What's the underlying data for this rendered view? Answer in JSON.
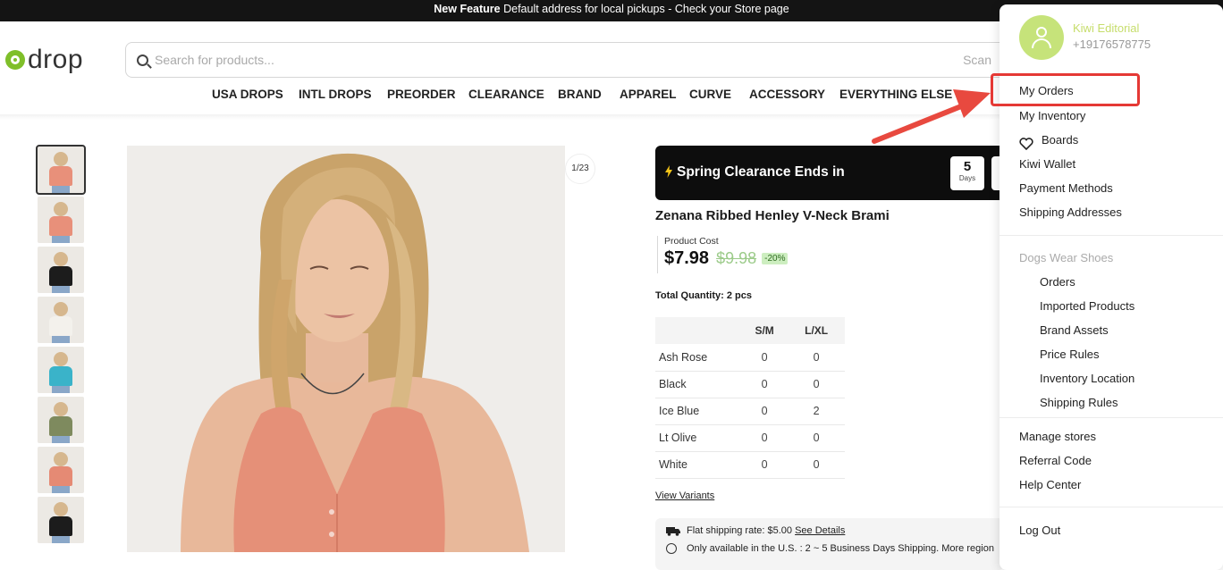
{
  "announcement": {
    "bold": "New Feature",
    "text": " Default address for local pickups - Check your Store page"
  },
  "logo": {
    "text": "drop",
    "icon": "drop-logo-icon"
  },
  "search": {
    "placeholder": "Search for products...",
    "scan_label": "Scan"
  },
  "nav": [
    {
      "label": "USA DROPS"
    },
    {
      "label": "INTL DROPS"
    },
    {
      "label": "PREORDER"
    },
    {
      "label": "CLEARANCE"
    },
    {
      "label": "BRAND"
    },
    {
      "label": "APPAREL"
    },
    {
      "label": "CURVE"
    },
    {
      "label": "ACCESSORY"
    },
    {
      "label": "EVERYTHING ELSE"
    }
  ],
  "gallery": {
    "counter": "1/23",
    "thumbnails": [
      {
        "color": "#e8907a"
      },
      {
        "color": "#e8907a"
      },
      {
        "color": "#1c1c1c"
      },
      {
        "color": "#f3f1ec"
      },
      {
        "color": "#3ab3c9"
      },
      {
        "color": "#7e8a5e"
      },
      {
        "color": "#e58a74"
      },
      {
        "color": "#1c1c1c"
      }
    ]
  },
  "promo": {
    "text": "Spring Clearance Ends in",
    "days_value": "5",
    "days_label": "Days"
  },
  "product": {
    "title": "Zenana Ribbed Henley V-Neck Brami",
    "cost_label": "Product Cost",
    "price": "$7.98",
    "old_price": "$9.98",
    "discount": "-20%",
    "total_quantity": "Total Quantity: 2 pcs"
  },
  "variants": {
    "headers": [
      "",
      "S/M",
      "L/XL"
    ],
    "rows": [
      {
        "color": "Ash Rose",
        "sm": "0",
        "lxl": "0"
      },
      {
        "color": "Black",
        "sm": "0",
        "lxl": "0"
      },
      {
        "color": "Ice Blue",
        "sm": "0",
        "lxl": "2"
      },
      {
        "color": "Lt Olive",
        "sm": "0",
        "lxl": "0"
      },
      {
        "color": "White",
        "sm": "0",
        "lxl": "0"
      }
    ],
    "view_link": "View Variants"
  },
  "shipping": {
    "rate_text": "Flat shipping rate: $5.00",
    "details_link": "See Details",
    "availability": "Only available in the U.S. : 2 ~ 5 Business Days Shipping. More region"
  },
  "account_menu": {
    "user_name": "Kiwi Editorial",
    "user_phone": "+19176578775",
    "items": [
      {
        "label": "My Orders"
      },
      {
        "label": "My Inventory"
      },
      {
        "label": "Boards"
      },
      {
        "label": "Kiwi Wallet"
      },
      {
        "label": "Payment Methods"
      },
      {
        "label": "Shipping Addresses"
      }
    ],
    "store_section": "Dogs Wear Shoes",
    "store_items": [
      {
        "label": "Orders"
      },
      {
        "label": "Imported Products"
      },
      {
        "label": "Brand Assets"
      },
      {
        "label": "Price Rules"
      },
      {
        "label": "Inventory Location"
      },
      {
        "label": "Shipping Rules"
      }
    ],
    "bottom_items": [
      {
        "label": "Manage stores"
      },
      {
        "label": "Referral Code"
      },
      {
        "label": "Help Center"
      }
    ],
    "logout": "Log Out"
  },
  "colors": {
    "accent_green": "#7fbf2a",
    "highlight_red": "#e53935",
    "promo_bg": "#0d0d0d"
  }
}
